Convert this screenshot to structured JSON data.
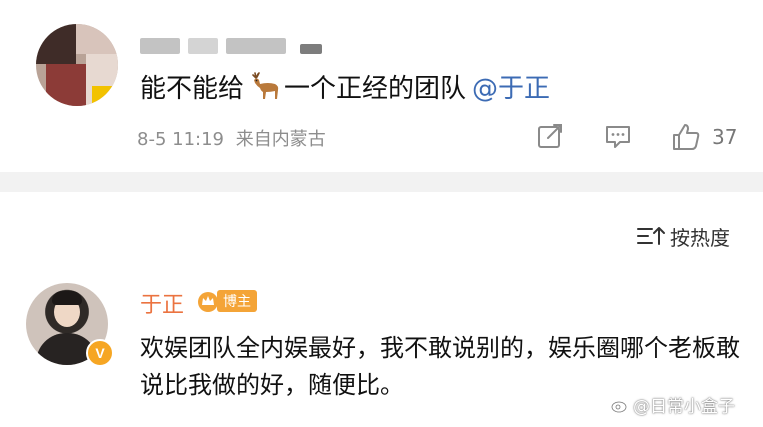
{
  "post": {
    "text_before": "能不能给",
    "text_after": "一个正经的团队",
    "mention": "@于正",
    "timestamp": "8-5 11:19",
    "location": "来自内蒙古",
    "like_count": "37",
    "icons": {
      "emoji": "deer-emoji-icon",
      "share": "share-icon",
      "comment": "comment-icon",
      "like": "thumbs-up-icon"
    }
  },
  "sort": {
    "label": "按热度",
    "icon": "sort-icon"
  },
  "reply": {
    "author": "于正",
    "badge_label": "博主",
    "verified": "V",
    "text": "欢娱团队全内娱最好，我不敢说别的，娱乐圈哪个老板敢说比我做的好，随便比。"
  },
  "watermark": {
    "text": "@日常小盒子",
    "icon": "weibo-icon"
  },
  "colors": {
    "mention": "#3c6bb4",
    "author": "#eb7340",
    "badge": "#f4a437",
    "meta": "#8d8d8d",
    "divider": "#f2f2f2"
  }
}
